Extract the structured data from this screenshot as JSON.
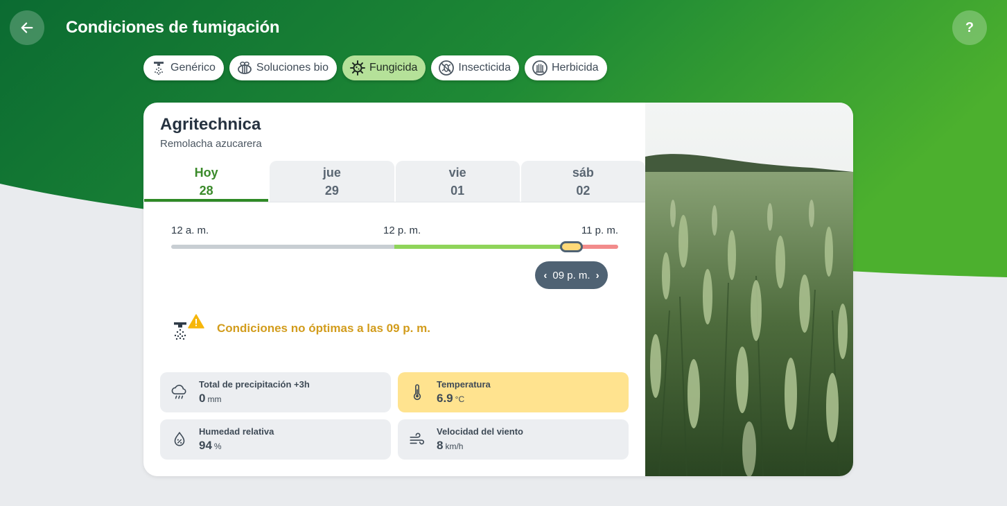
{
  "header": {
    "title": "Condiciones de fumigación",
    "help_label": "?"
  },
  "chips": [
    {
      "label": "Genérico",
      "icon": "sprayer-icon",
      "active": false
    },
    {
      "label": "Soluciones bio",
      "icon": "bee-icon",
      "active": false
    },
    {
      "label": "Fungicida",
      "icon": "virus-icon",
      "active": true
    },
    {
      "label": "Insecticida",
      "icon": "no-insect-icon",
      "active": false
    },
    {
      "label": "Herbicida",
      "icon": "grass-icon",
      "active": false
    }
  ],
  "card": {
    "location": "Agritechnica",
    "crop": "Remolacha azucarera",
    "days": [
      {
        "name": "Hoy",
        "num": "28",
        "active": true
      },
      {
        "name": "jue",
        "num": "29",
        "active": false
      },
      {
        "name": "vie",
        "num": "01",
        "active": false
      },
      {
        "name": "sáb",
        "num": "02",
        "active": false
      }
    ],
    "timeline": {
      "start": "12 a. m.",
      "mid": "12 p. m.",
      "end": "11 p. m.",
      "selected": "09 p. m.",
      "colors": {
        "past": "#c8ced3",
        "optimal": "#8fd45a",
        "not_optimal": "#f28b8b",
        "handle": "#ffd978"
      }
    },
    "warning": "Condiciones no óptimas a las 09 p. m.",
    "metrics": [
      {
        "label": "Total de precipitación +3h",
        "value": "0",
        "unit": "mm",
        "icon": "rain-cloud-icon",
        "highlight": false
      },
      {
        "label": "Temperatura",
        "value": "6.9",
        "unit": "°C",
        "icon": "thermometer-icon",
        "highlight": true
      },
      {
        "label": "Humedad relativa",
        "value": "94",
        "unit": "%",
        "icon": "humidity-drop-icon",
        "highlight": false
      },
      {
        "label": "Velocidad del viento",
        "value": "8",
        "unit": "km/h",
        "icon": "wind-icon",
        "highlight": false
      }
    ]
  }
}
